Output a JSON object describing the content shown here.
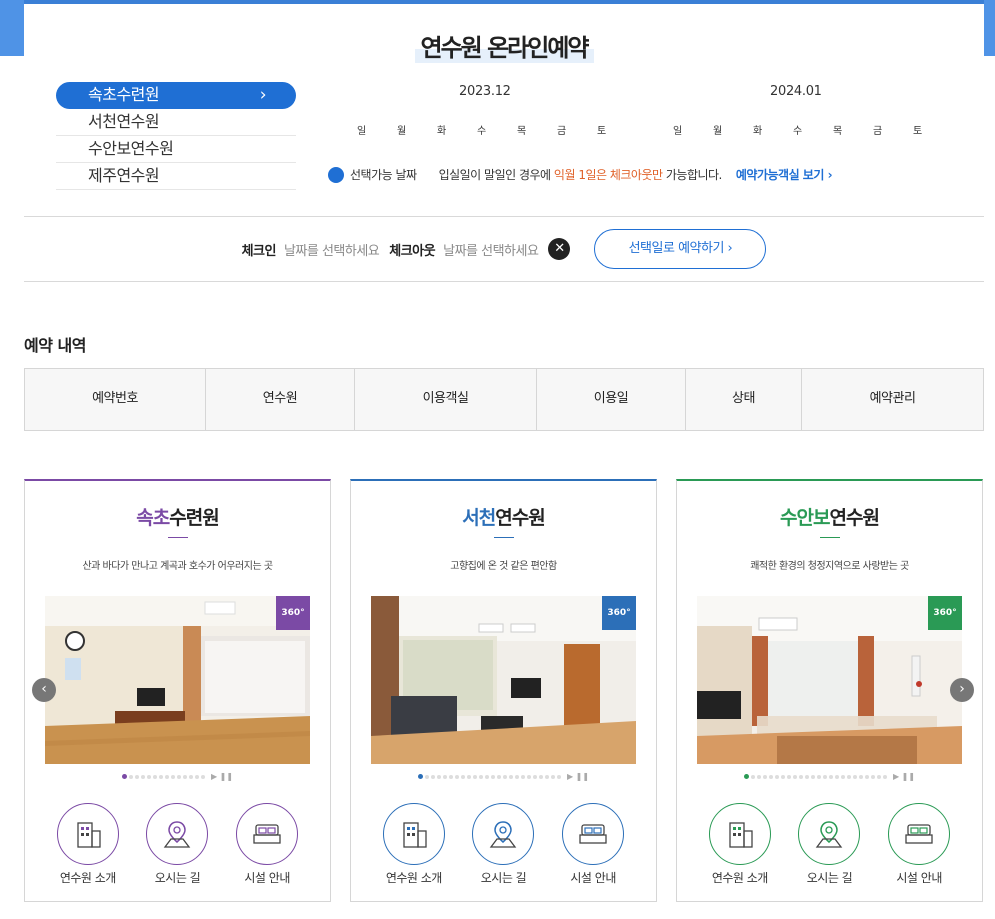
{
  "page_title": "연수원 온라인예약",
  "sidebar": {
    "items": [
      {
        "label": "속초수련원"
      },
      {
        "label": "서천연수원"
      },
      {
        "label": "수안보연수원"
      },
      {
        "label": "제주연수원"
      }
    ],
    "active_chevron": "›"
  },
  "calendar": {
    "month1": "2023.12",
    "month2": "2024.01",
    "weekdays": [
      "일",
      "월",
      "화",
      "수",
      "목",
      "금",
      "토"
    ]
  },
  "legend": {
    "available_label": "선택가능 날짜",
    "note_prefix": "입실일이 말일인 경우에 ",
    "note_highlight": "익월 1일은 체크아웃만",
    "note_suffix": " 가능합니다.",
    "link_label": "예약가능객실 보기 ›"
  },
  "checkin": {
    "checkin_label": "체크인",
    "checkin_placeholder": "날짜를 선택하세요",
    "checkout_label": "체크아웃",
    "checkout_placeholder": "날짜를 선택하세요",
    "clear_label": "✕",
    "reserve_label": "선택일로 예약하기 ›"
  },
  "history": {
    "title": "예약 내역",
    "columns": [
      "예약번호",
      "연수원",
      "이용객실",
      "이용일",
      "상태",
      "예약관리"
    ]
  },
  "cards": [
    {
      "title_accent": "속초",
      "title_rest": "수련원",
      "subtitle": "산과 바다가 만나고 계곡과 호수가 어우러지는 곳",
      "accent_color": "#7b4aa5",
      "badge": "360°",
      "pager_controls": "▶ ❚❚",
      "links": [
        "연수원 소개",
        "오시는 길",
        "시설 안내"
      ]
    },
    {
      "title_accent": "서천",
      "title_rest": "연수원",
      "subtitle": "고향집에 온 것 같은 편안함",
      "accent_color": "#2c6fb8",
      "badge": "360°",
      "pager_controls": "▶ ❚❚",
      "links": [
        "연수원 소개",
        "오시는 길",
        "시설 안내"
      ]
    },
    {
      "title_accent": "수안보",
      "title_rest": "연수원",
      "subtitle": "쾌적한 환경의 청정지역으로 사랑받는 곳",
      "accent_color": "#2a9a55",
      "badge": "360°",
      "pager_controls": "▶ ❚❚",
      "links": [
        "연수원 소개",
        "오시는 길",
        "시설 안내"
      ]
    }
  ],
  "slider": {
    "prev": "‹",
    "next": "›"
  }
}
